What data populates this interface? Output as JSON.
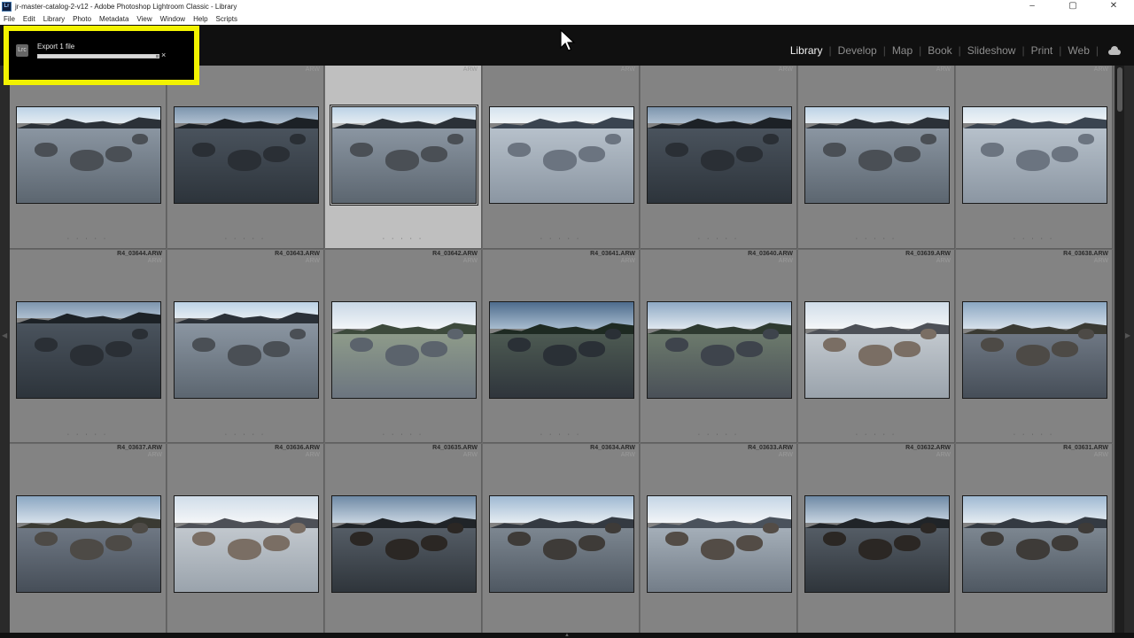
{
  "window": {
    "title": "jr-master-catalog-2-v12 - Adobe Photoshop Lightroom Classic - Library",
    "controls": [
      "–",
      "▢",
      "✕"
    ]
  },
  "menu": [
    "File",
    "Edit",
    "Library",
    "Photo",
    "Metadata",
    "View",
    "Window",
    "Help",
    "Scripts"
  ],
  "logo": "Lrc",
  "modules": [
    "Library",
    "Develop",
    "Map",
    "Book",
    "Slideshow",
    "Print",
    "Web"
  ],
  "active_module": "Library",
  "export": {
    "label": "Export 1 file",
    "progress_fraction": 0.98,
    "cancel": "×"
  },
  "grid": {
    "rows": [
      {
        "cells": [
          {
            "name": "",
            "ext": "",
            "stars": "· · · · ·",
            "scene": "sea"
          },
          {
            "name": "",
            "ext": "ARW",
            "stars": "· · · · ·",
            "scene": "sea-dark"
          },
          {
            "name": "",
            "ext": "ARW",
            "stars": "· · · · ·",
            "scene": "sea",
            "selected": true
          },
          {
            "name": "",
            "ext": "ARW",
            "stars": "· · · · ·",
            "scene": "sea-light"
          },
          {
            "name": "",
            "ext": "ARW",
            "stars": "· · · · ·",
            "scene": "sea-dark"
          },
          {
            "name": "",
            "ext": "ARW",
            "stars": "· · · · ·",
            "scene": "sea"
          },
          {
            "name": "",
            "ext": "ARW",
            "stars": "· · · · ·",
            "scene": "sea-light"
          }
        ]
      },
      {
        "cells": [
          {
            "name": "R4_03644.ARW",
            "ext": "ARW",
            "stars": "· · · · ·",
            "scene": "sea-dark"
          },
          {
            "name": "R4_03643.ARW",
            "ext": "ARW",
            "stars": "· · · · ·",
            "scene": "sea"
          },
          {
            "name": "R4_03642.ARW",
            "ext": "ARW",
            "stars": "· · · · ·",
            "scene": "shore-light"
          },
          {
            "name": "R4_03641.ARW",
            "ext": "ARW",
            "stars": "· · · · ·",
            "scene": "shore-dark"
          },
          {
            "name": "R4_03640.ARW",
            "ext": "ARW",
            "stars": "· · · · ·",
            "scene": "shore"
          },
          {
            "name": "R4_03639.ARW",
            "ext": "ARW",
            "stars": "· · · · ·",
            "scene": "beach-light"
          },
          {
            "name": "R4_03638.ARW",
            "ext": "ARW",
            "stars": "· · · · ·",
            "scene": "beach"
          }
        ]
      },
      {
        "cells": [
          {
            "name": "R4_03637.ARW",
            "ext": "ARW",
            "stars": "",
            "scene": "beach"
          },
          {
            "name": "R4_03636.ARW",
            "ext": "ARW",
            "stars": "",
            "scene": "beach-light"
          },
          {
            "name": "R4_03635.ARW",
            "ext": "ARW",
            "stars": "",
            "scene": "rocks-dark"
          },
          {
            "name": "R4_03634.ARW",
            "ext": "ARW",
            "stars": "",
            "scene": "rocks"
          },
          {
            "name": "R4_03633.ARW",
            "ext": "ARW",
            "stars": "",
            "scene": "rocks-light"
          },
          {
            "name": "R4_03632.ARW",
            "ext": "ARW",
            "stars": "",
            "scene": "rocks-dark"
          },
          {
            "name": "R4_03631.ARW",
            "ext": "ARW",
            "stars": "",
            "scene": "rocks"
          }
        ]
      }
    ]
  },
  "colors": {
    "highlight": "#f2f200",
    "grid_cell": "#838383",
    "selected_cell": "#bfbfbf",
    "active_module": "#f2f2f2",
    "inactive_module": "#8d8d8d"
  },
  "icons": {
    "cloud": "cloud-icon",
    "cursor": "mouse-pointer-icon",
    "cancel": "close-icon"
  }
}
